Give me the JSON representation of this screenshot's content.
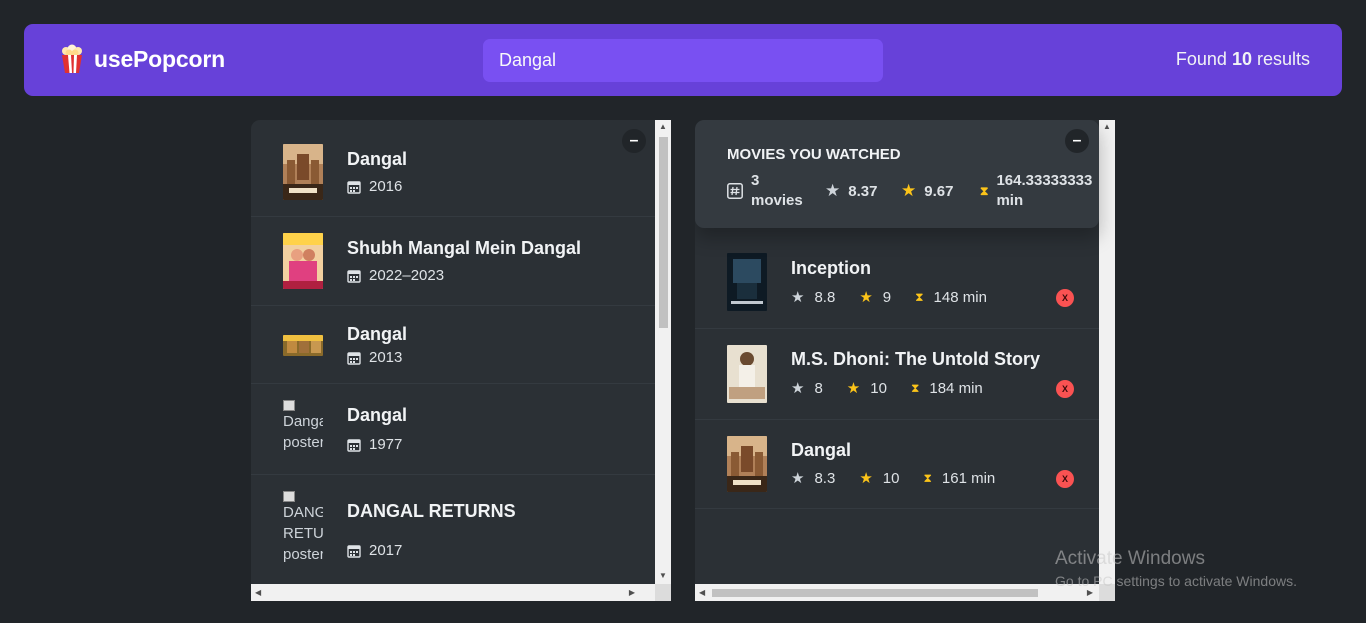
{
  "nav": {
    "logo_text": "usePopcorn",
    "search_value": "Dangal",
    "results_prefix": "Found",
    "results_count": "10",
    "results_suffix": "results"
  },
  "buttons": {
    "toggle_label": "–",
    "delete_label": "X"
  },
  "movies": [
    {
      "title": "Dangal",
      "year": "2016",
      "poster": "image"
    },
    {
      "title": "Shubh Mangal Mein Dangal",
      "year": "2022–2023",
      "poster": "image"
    },
    {
      "title": "Dangal",
      "year": "2013",
      "poster": "image"
    },
    {
      "title": "Dangal",
      "year": "1977",
      "poster": "broken",
      "alt_lines": [
        "Dangal",
        "poster"
      ]
    },
    {
      "title": "DANGAL RETURNS",
      "year": "2017",
      "poster": "broken",
      "alt_lines": [
        "DANGAL",
        "RETURNS",
        "poster"
      ]
    }
  ],
  "summary": {
    "heading": "Movies you watched",
    "movies_count": "3",
    "movies_label": "movies",
    "avg_imdb": "8.37",
    "avg_user": "9.67",
    "avg_runtime": "164.33333333",
    "runtime_unit": "min"
  },
  "watched": [
    {
      "title": "Inception",
      "imdb": "8.8",
      "user": "9",
      "runtime": "148 min"
    },
    {
      "title": "M.S. Dhoni: The Untold Story",
      "imdb": "8",
      "user": "10",
      "runtime": "184 min"
    },
    {
      "title": "Dangal",
      "imdb": "8.3",
      "user": "10",
      "runtime": "161 min"
    }
  ],
  "watermark": {
    "line1": "Activate Windows",
    "line2": "Go to PC settings to activate Windows."
  },
  "colors": {
    "bg": "#212529",
    "nav": "#6741d9",
    "search": "#7950f2",
    "box": "#2b3035",
    "summary": "#343a40",
    "delete": "#fa5252"
  }
}
